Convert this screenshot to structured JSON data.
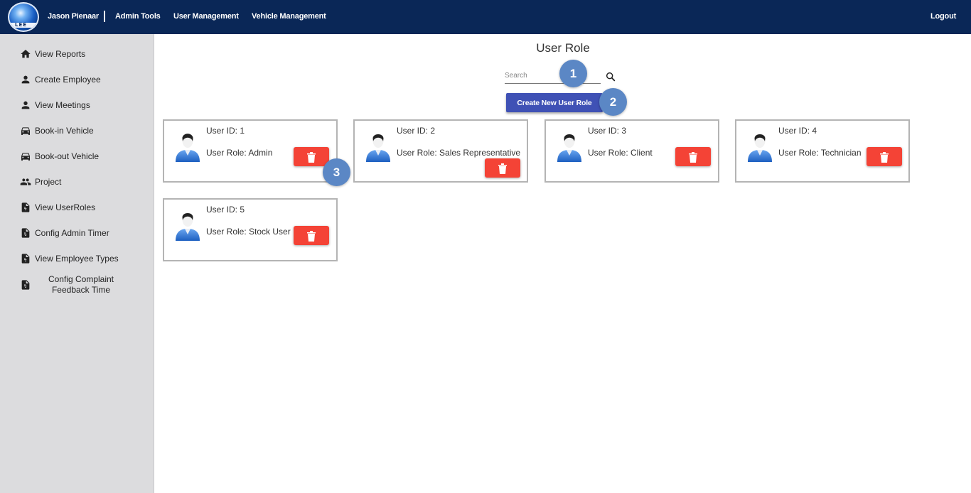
{
  "header": {
    "user_name": "Jason Pienaar",
    "nav": [
      "Admin Tools",
      "User Management",
      "Vehicle Management"
    ],
    "logout": "Logout",
    "logo_text": "LEE"
  },
  "sidebar": {
    "items": [
      {
        "label": "View Reports",
        "icon": "home-icon"
      },
      {
        "label": "Create Employee",
        "icon": "person-icon"
      },
      {
        "label": "View Meetings",
        "icon": "person-icon"
      },
      {
        "label": "Book-in Vehicle",
        "icon": "car-icon"
      },
      {
        "label": "Book-out Vehicle",
        "icon": "car-icon"
      },
      {
        "label": "Project",
        "icon": "people-icon"
      },
      {
        "label": "View UserRoles",
        "icon": "document-icon"
      },
      {
        "label": "Config Admin Timer",
        "icon": "document-icon"
      },
      {
        "label": "View Employee Types",
        "icon": "document-icon"
      },
      {
        "label": "Config Complaint Feedback Time",
        "icon": "document-icon"
      }
    ]
  },
  "main": {
    "title": "User Role",
    "search": {
      "placeholder": "Search",
      "value": ""
    },
    "create_button": "Create New User Role",
    "markers": [
      "1",
      "2",
      "3"
    ],
    "roles": [
      {
        "id_text": "User ID: 1",
        "role_text": "User Role: Admin"
      },
      {
        "id_text": "User ID: 2",
        "role_text": "User Role: Sales Representative"
      },
      {
        "id_text": "User ID: 3",
        "role_text": "User Role: Client"
      },
      {
        "id_text": "User ID: 4",
        "role_text": "User Role: Technician"
      },
      {
        "id_text": "User ID: 5",
        "role_text": "User Role: Stock User"
      }
    ]
  },
  "colors": {
    "topbar": "#0a2757",
    "sidebar": "#dcdcde",
    "primary_button": "#3f51b5",
    "delete_button": "#f44336",
    "marker": "#5b87c5"
  }
}
